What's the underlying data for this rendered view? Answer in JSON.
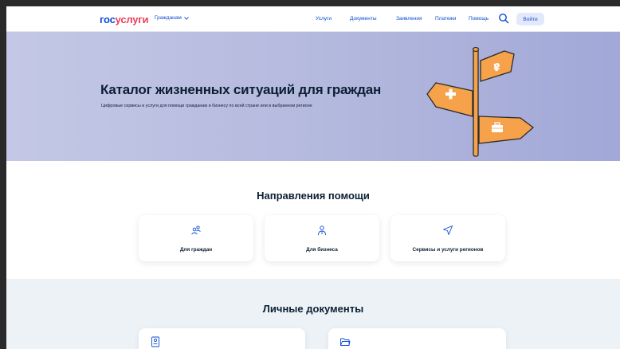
{
  "header": {
    "logo_part1": "гос",
    "logo_part2": "услуги",
    "audience_label": "Гражданам",
    "nav": [
      "Услуги",
      "Документы",
      "Заявления",
      "Платежи",
      "Помощь"
    ],
    "search_icon": "search-icon",
    "login_label": "Войти"
  },
  "hero": {
    "title": "Каталог жизненных ситуаций для граждан",
    "subtitle": "Цифровые сервисы и услуги для помощи гражданам и бизнесу по всей стране или в выбранном регионе",
    "illustration": "signpost-illustration"
  },
  "directions": {
    "title": "Направления помощи",
    "cards": [
      {
        "label": "Для граждан",
        "icon": "people-icon"
      },
      {
        "label": "Для бизнеса",
        "icon": "person-icon"
      },
      {
        "label": "Сервисы и услуги регионов",
        "icon": "navigation-arrow-icon"
      }
    ]
  },
  "documents": {
    "title": "Личные документы",
    "cards": [
      {
        "icon": "id-card-icon"
      },
      {
        "icon": "folder-icon"
      }
    ]
  },
  "colors": {
    "brand_blue": "#0d4cd3",
    "brand_red": "#ee3f58",
    "hero_bg": "#b6bbdf",
    "sign_orange": "#f5a24b",
    "docs_bg": "#edf2f7"
  }
}
